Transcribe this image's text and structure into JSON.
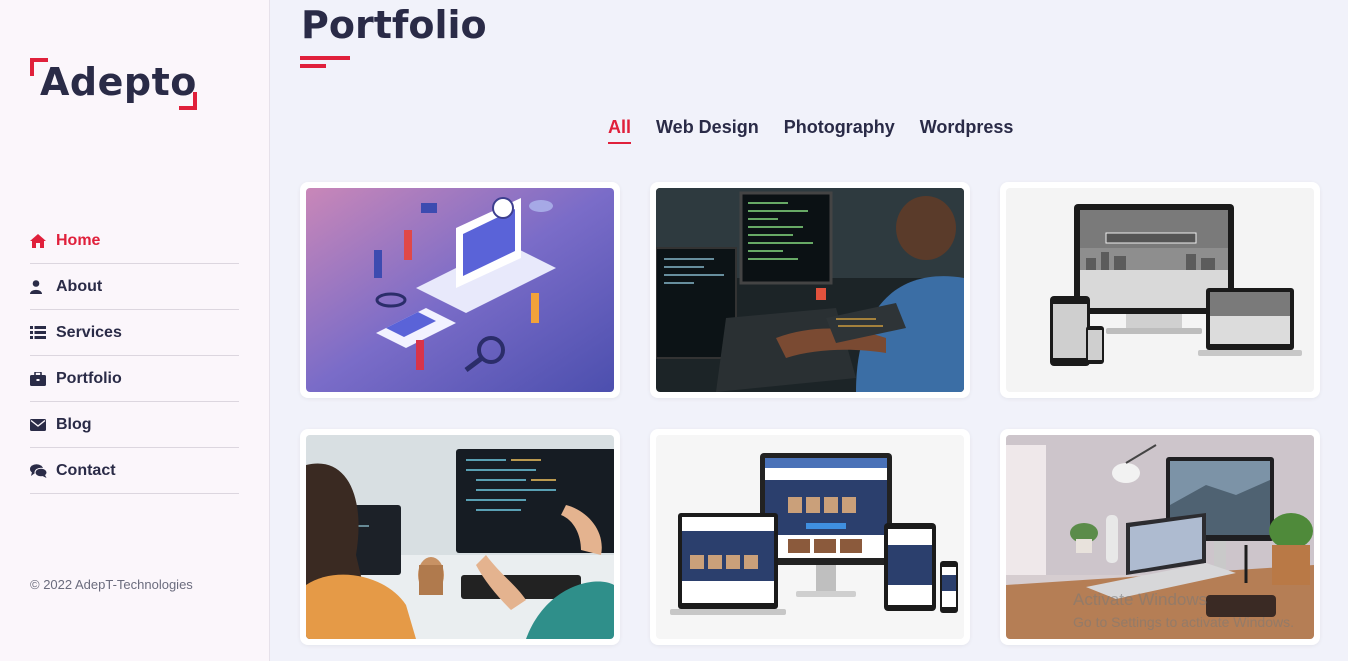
{
  "brand": {
    "name": "Adepto",
    "accent": "#e0203b"
  },
  "nav": [
    {
      "label": "Home",
      "icon": "home-icon",
      "active": true
    },
    {
      "label": "About",
      "icon": "user-icon"
    },
    {
      "label": "Services",
      "icon": "list-icon"
    },
    {
      "label": "Portfolio",
      "icon": "briefcase-icon"
    },
    {
      "label": "Blog",
      "icon": "envelope-icon"
    },
    {
      "label": "Contact",
      "icon": "comments-icon"
    }
  ],
  "footer": {
    "copyright": "© 2022 AdepT-Technologies"
  },
  "page": {
    "title": "Portfolio"
  },
  "filters": [
    {
      "label": "All",
      "active": true
    },
    {
      "label": "Web Design"
    },
    {
      "label": "Photography"
    },
    {
      "label": "Wordpress"
    }
  ],
  "portfolio_items": [
    {
      "name": "isometric-web-development-illustration"
    },
    {
      "name": "developer-coding-at-night"
    },
    {
      "name": "responsive-website-mockup-yafmedia"
    },
    {
      "name": "programmers-working-on-code"
    },
    {
      "name": "responsive-devices-mockup"
    },
    {
      "name": "desk-workspace-laptop-monitor"
    }
  ],
  "os_watermark": {
    "line1": "Activate Windows",
    "line2": "Go to Settings to activate Windows."
  }
}
